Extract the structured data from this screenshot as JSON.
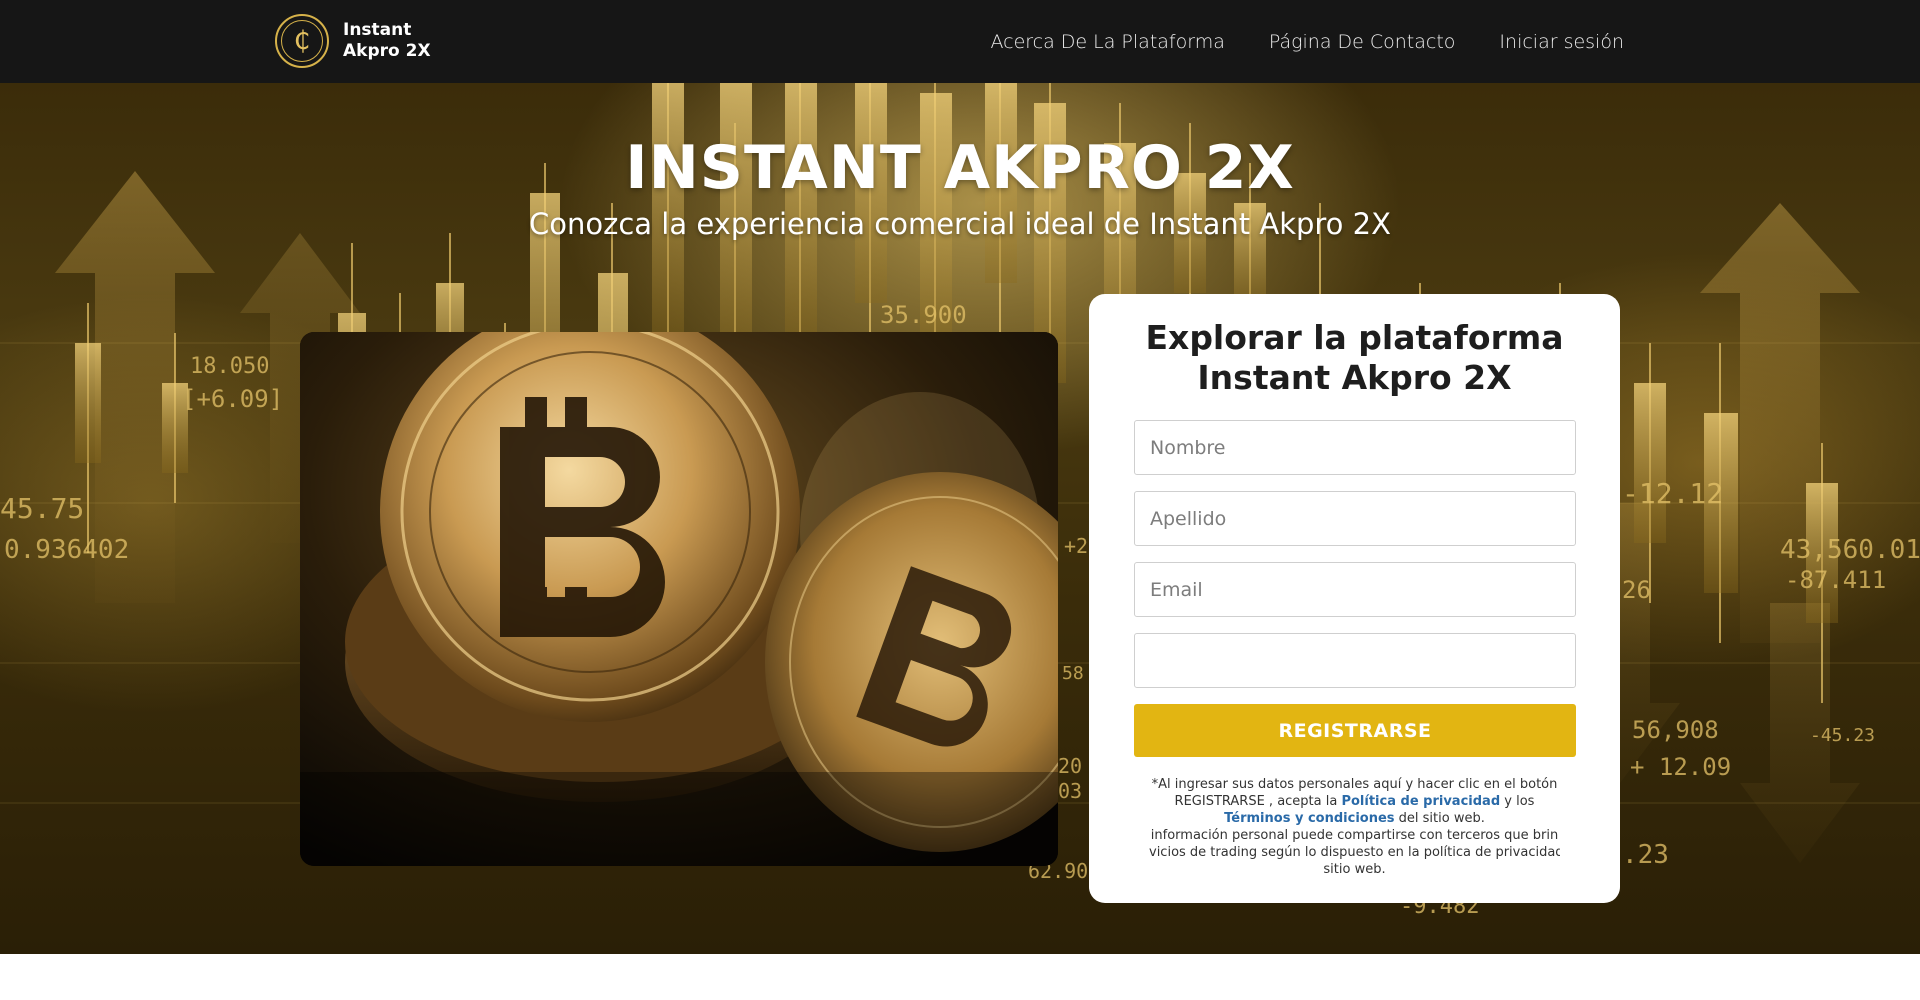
{
  "brand": {
    "line1": "Instant",
    "line2": "Akpro 2X",
    "logo_glyph": "₵",
    "accent": "#d6b24a"
  },
  "nav": {
    "links": [
      "Acerca De La Plataforma",
      "Página De Contacto",
      "Iniciar sesión"
    ]
  },
  "hero": {
    "title": "INSTANT AKPRO 2X",
    "subtitle": "Conozca la experiencia comercial ideal de Instant Akpro 2X",
    "bg_numbers": [
      "18.050",
      "[+6.09]",
      "45.75",
      "0.936402",
      "35.900",
      "-12.12",
      "43,560.01",
      "-87.411",
      "26",
      "56,908",
      "-45.23",
      "+ 12.09",
      ".23",
      "-9.482",
      "62.90",
      "20",
      "03",
      "+2",
      "58"
    ]
  },
  "form": {
    "title_line1": "Explorar la plataforma",
    "title_line2": "Instant Akpro 2X",
    "first_name_placeholder": "Nombre",
    "last_name_placeholder": "Apellido",
    "email_placeholder": "Email",
    "phone_value": "",
    "submit_label": "REGISTRARSE",
    "button_color": "#e2b512",
    "disclaimer": {
      "l1": "*Al ingresar sus datos personales aquí y hacer clic en el botón",
      "l2a": "REGISTRARSE , acepta la ",
      "privacy": "Política de privacidad",
      "l2b": " y los",
      "terms": "Términos y condiciones",
      "l3b": " del sitio web.",
      "l4": "información personal puede compartirse con terceros que brin",
      "l5": "vicios de trading según lo dispuesto en la política de privacidad",
      "l6": "sitio web."
    }
  }
}
